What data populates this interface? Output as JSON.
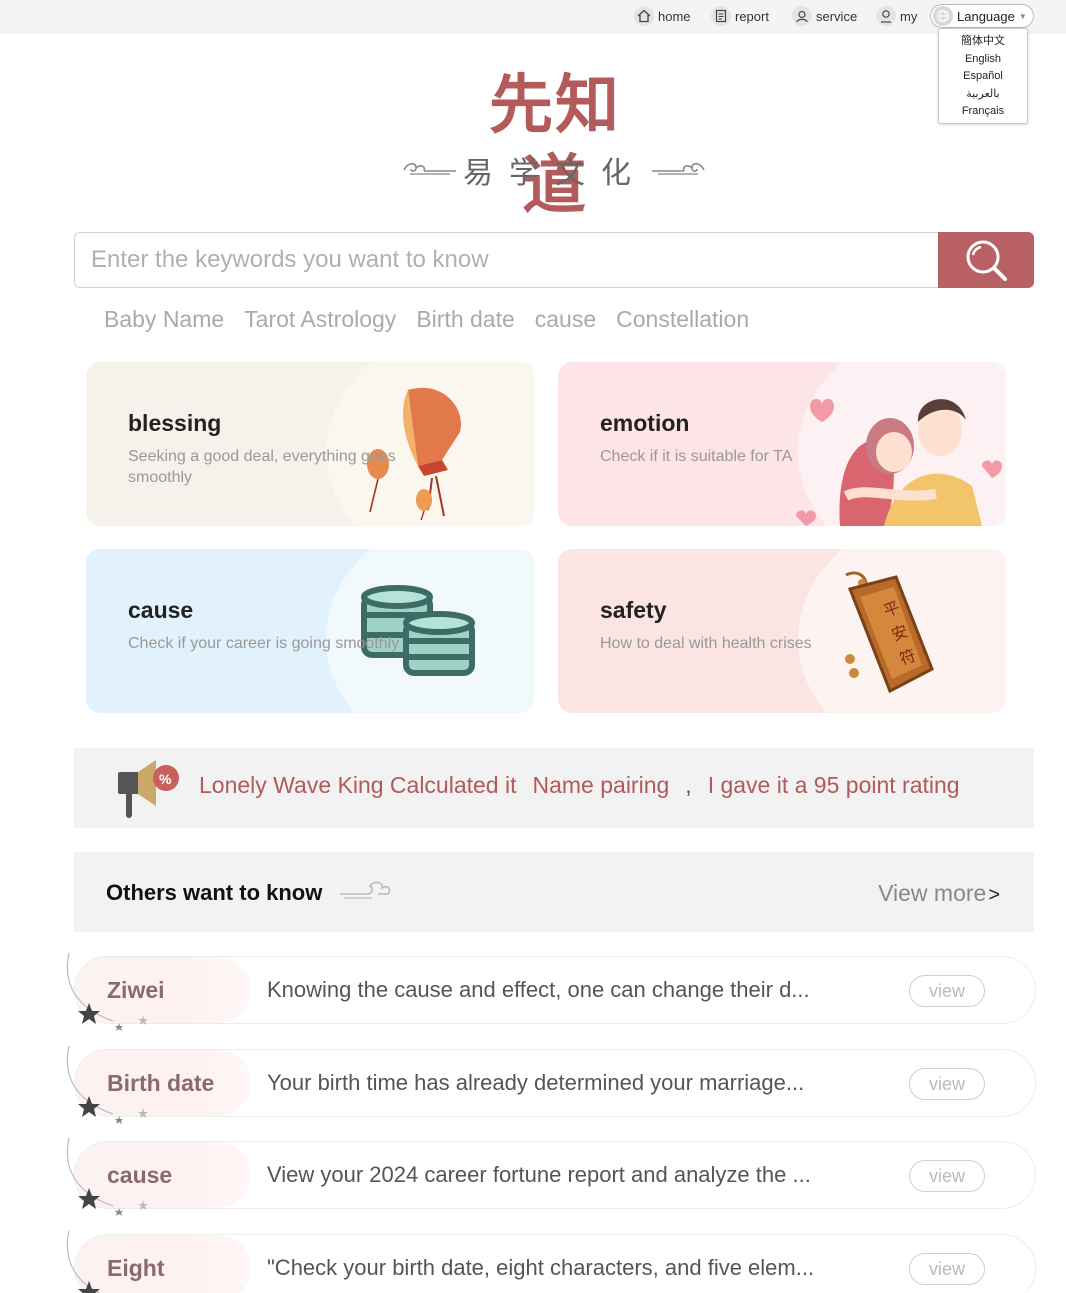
{
  "nav": {
    "home": "home",
    "report": "report",
    "service": "service",
    "my": "my",
    "language": "Language",
    "language_options": [
      "簡体中文",
      "English",
      "Español",
      "بالعربية",
      "Français"
    ]
  },
  "logo": {
    "main": "先知道",
    "sub": "易学文化"
  },
  "search": {
    "placeholder": "Enter the keywords you want to know"
  },
  "hot_tags": [
    "Baby Name",
    "Tarot Astrology",
    "Birth date",
    "cause",
    "Constellation"
  ],
  "cards": [
    {
      "title": "blessing",
      "desc": "Seeking a good deal, everything goes smoothly"
    },
    {
      "title": "emotion",
      "desc": "Check if it is suitable for TA"
    },
    {
      "title": "cause",
      "desc": "Check if your career is going smoothly"
    },
    {
      "title": "safety",
      "desc": "How to deal with health crises"
    }
  ],
  "announcement": {
    "user": "Lonely Wave King Calculated it",
    "item": "Name pairing",
    "sep": ",",
    "rating": "I gave it a 95 point rating",
    "badge": "%"
  },
  "others": {
    "title": "Others want to know",
    "view_more": "View more",
    "view_more_arrow": ">"
  },
  "list": [
    {
      "tag": "Ziwei",
      "title": "Knowing the cause and effect, one can change their d...",
      "button": "view"
    },
    {
      "tag": "Birth date",
      "title": "Your birth time has already determined your marriage...",
      "button": "view"
    },
    {
      "tag": "cause",
      "title": "View your 2024 career fortune report and analyze the ...",
      "button": "view"
    },
    {
      "tag": "Eight",
      "title": "\"Check your birth date, eight characters, and five elem...",
      "button": "view"
    }
  ],
  "colors": {
    "brand": "#b86063",
    "announcement_text": "#b05a5a"
  }
}
